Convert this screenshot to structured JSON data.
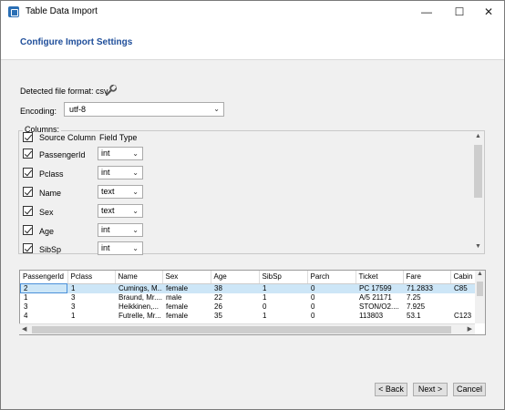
{
  "window": {
    "title": "Table Data Import",
    "controls": {
      "minimize": "—",
      "maximize": "☐",
      "close": "✕"
    }
  },
  "page_title": "Configure Import Settings",
  "detected_format_label": "Detected file format: csv",
  "encoding": {
    "label": "Encoding:",
    "value": "utf-8"
  },
  "columns": {
    "legend": "Columns:",
    "header_source": "Source Column",
    "header_type": "Field Type",
    "items": [
      {
        "name": "PassengerId",
        "type": "int"
      },
      {
        "name": "Pclass",
        "type": "int"
      },
      {
        "name": "Name",
        "type": "text"
      },
      {
        "name": "Sex",
        "type": "text"
      },
      {
        "name": "Age",
        "type": "int"
      },
      {
        "name": "SibSp",
        "type": "int"
      }
    ]
  },
  "preview": {
    "headers": [
      "PassengerId",
      "Pclass",
      "Name",
      "Sex",
      "Age",
      "SibSp",
      "Parch",
      "Ticket",
      "Fare",
      "Cabin"
    ],
    "rows": [
      [
        "2",
        "1",
        "Cumings, M...",
        "female",
        "38",
        "1",
        "0",
        "PC 17599",
        "71.2833",
        "C85"
      ],
      [
        "1",
        "3",
        "Braund, Mr....",
        "male",
        "22",
        "1",
        "0",
        "A/5 21171",
        "7.25",
        ""
      ],
      [
        "3",
        "3",
        "Heikkinen,...",
        "female",
        "26",
        "0",
        "0",
        "STON/O2....",
        "7.925",
        ""
      ],
      [
        "4",
        "1",
        "Futrelle, Mr...",
        "female",
        "35",
        "1",
        "0",
        "113803",
        "53.1",
        "C123"
      ]
    ]
  },
  "buttons": {
    "back": "< Back",
    "next": "Next >",
    "cancel": "Cancel"
  }
}
